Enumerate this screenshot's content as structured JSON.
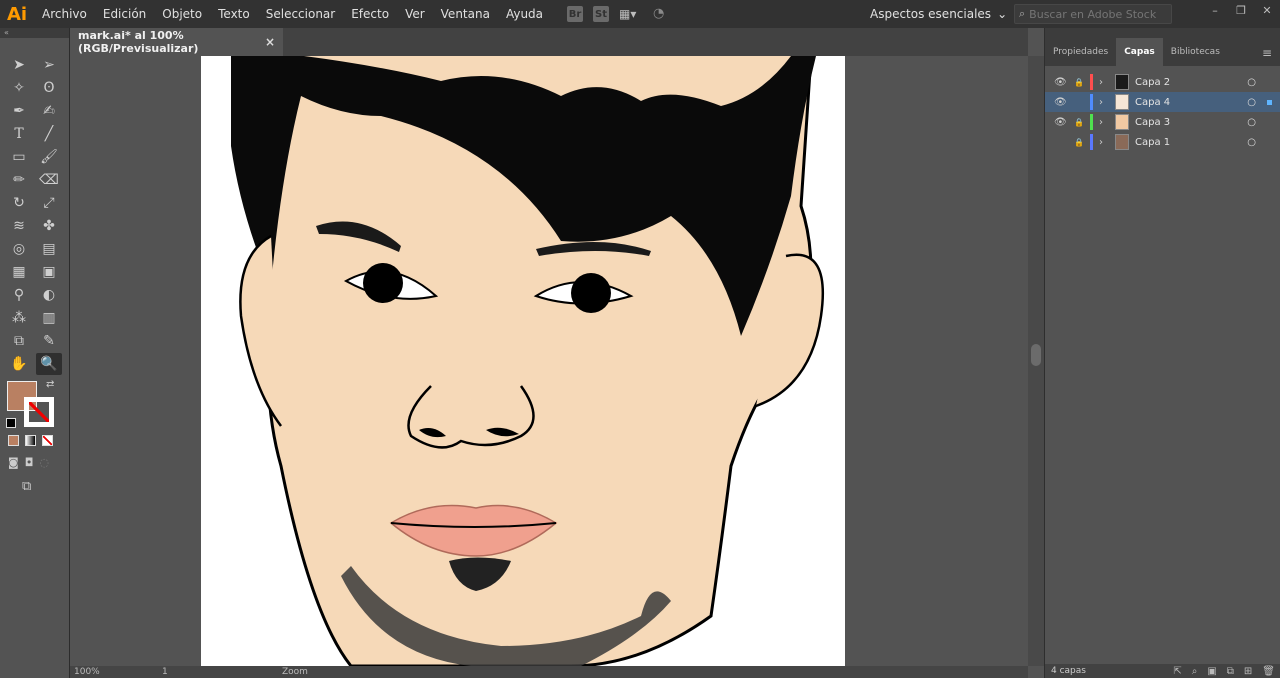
{
  "app": {
    "logo": "Ai"
  },
  "menu": [
    "Archivo",
    "Edición",
    "Objeto",
    "Texto",
    "Seleccionar",
    "Efecto",
    "Ver",
    "Ventana",
    "Ayuda"
  ],
  "menubar_icons": [
    "Br",
    "St"
  ],
  "workspace": {
    "label": "Aspectos esenciales"
  },
  "search": {
    "placeholder": "Buscar en Adobe Stock"
  },
  "document": {
    "tab_title": "mark.ai* al 100% (RGB/Previsualizar)",
    "close_glyph": "×"
  },
  "colors": {
    "fill": "#b98062",
    "accent": "#46607d"
  },
  "statusbar": {
    "zoom": "100%",
    "page": "1",
    "mode": "Zoom"
  },
  "panel": {
    "tabs": [
      "Propiedades",
      "Capas",
      "Bibliotecas"
    ],
    "active_tab": "Capas",
    "layers": [
      {
        "name": "Capa 2",
        "visible": true,
        "locked": true,
        "color": "#ff4e4e",
        "selected": false
      },
      {
        "name": "Capa 4",
        "visible": true,
        "locked": false,
        "color": "#4f8cff",
        "selected": true
      },
      {
        "name": "Capa 3",
        "visible": true,
        "locked": true,
        "color": "#4fe04f",
        "selected": false
      },
      {
        "name": "Capa 1",
        "visible": false,
        "locked": true,
        "color": "#5a78ff",
        "selected": false
      }
    ],
    "footer_count": "4 capas"
  }
}
